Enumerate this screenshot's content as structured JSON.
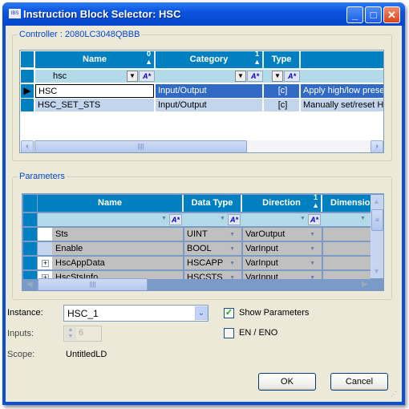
{
  "window": {
    "title": "Instruction Block Selector: HSC",
    "icon": "app-icon",
    "buttons": [
      "minimize",
      "maximize",
      "close"
    ]
  },
  "controller": {
    "label": "Controller : 2080LC3048QBBB",
    "columns": [
      {
        "label": "Name",
        "sort": "0"
      },
      {
        "label": "Category",
        "sort": "1"
      },
      {
        "label": "Type"
      },
      {
        "label": ""
      }
    ],
    "filter": {
      "name": "hsc"
    },
    "rows": [
      {
        "name": "HSC",
        "category": "Input/Output",
        "type_icon": "function-block-icon",
        "description": "Apply high/low prese",
        "selected": true
      },
      {
        "name": "HSC_SET_STS",
        "category": "Input/Output",
        "type_icon": "function-block-icon",
        "description": "Manually set/reset HS"
      }
    ]
  },
  "parameters": {
    "label": "Parameters",
    "columns": [
      {
        "label": "Name"
      },
      {
        "label": "Data Type"
      },
      {
        "label": "Direction",
        "sort": "1"
      },
      {
        "label": "Dimensio"
      }
    ],
    "rows": [
      {
        "name": "Sts",
        "data_type": "UINT",
        "direction": "VarOutput",
        "expandable": false
      },
      {
        "name": "Enable",
        "data_type": "BOOL",
        "direction": "VarInput",
        "expandable": false
      },
      {
        "name": "HscAppData",
        "data_type": "HSCAPP",
        "direction": "VarInput",
        "expandable": true
      },
      {
        "name": "HscStsInfo",
        "data_type": "HSCSTS",
        "direction": "VarInput",
        "expandable": true
      }
    ]
  },
  "form": {
    "instance_label": "Instance:",
    "instance_value": "HSC_1",
    "inputs_label": "Inputs:",
    "inputs_value": "6",
    "scope_label": "Scope:",
    "scope_value": "UntitledLD",
    "show_parameters_label": "Show Parameters",
    "show_parameters_checked": true,
    "en_eno_label": "EN / ENO",
    "en_eno_checked": false
  },
  "buttons": {
    "ok": "OK",
    "cancel": "Cancel"
  }
}
